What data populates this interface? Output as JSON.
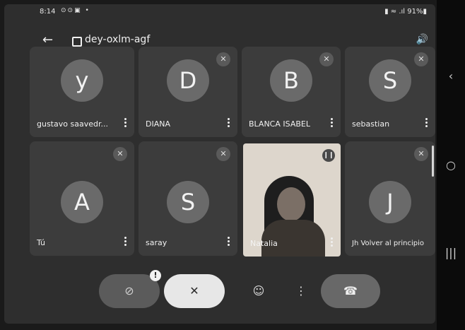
{
  "status_bar": {
    "time": "8:14",
    "left_icons": "⊙⊙▣ •",
    "right_text": "▮ ≈ .ıl 91%▮"
  },
  "header": {
    "meeting_code": "dey-oxlm-agf"
  },
  "participants": [
    {
      "initial": "y",
      "name": "gustavo saavedr..."
    },
    {
      "initial": "D",
      "name": "DIANA"
    },
    {
      "initial": "B",
      "name": "BLANCA ISABEL"
    },
    {
      "initial": "S",
      "name": "sebastian"
    },
    {
      "initial": "A",
      "name": "Tú"
    },
    {
      "initial": "S",
      "name": "saray"
    },
    {
      "initial": "",
      "name": "Natalia"
    },
    {
      "initial": "J",
      "name": "Jh Volver al principio"
    }
  ],
  "controls": {
    "camera_badge": "!"
  },
  "icons": {
    "back": "back-arrow-icon",
    "calendar": "calendar-icon",
    "speaker": "speaker-icon",
    "mute": "mic-off-icon",
    "camera": "camera-off-icon",
    "emoji": "emoji-icon",
    "more": "more-vert-icon",
    "hangup": "hang-up-icon"
  },
  "colors": {
    "background": "#2e2e2e",
    "tile": "#3c3c3c",
    "avatar": "#6a6a6a"
  }
}
